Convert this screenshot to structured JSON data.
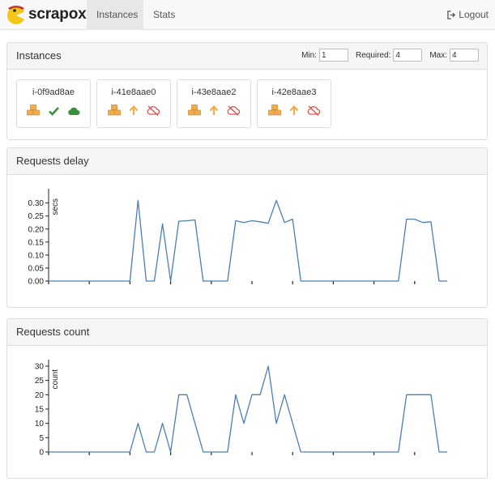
{
  "navbar": {
    "brand": "scrapoxy",
    "tabs": [
      {
        "label": "Instances",
        "active": true
      },
      {
        "label": "Stats",
        "active": false
      }
    ],
    "logout_label": "Logout",
    "logout_icon": "sign-out-icon"
  },
  "instances_panel": {
    "title": "Instances",
    "min_label": "Min:",
    "min_value": "1",
    "required_label": "Required:",
    "required_value": "4",
    "max_label": "Max:",
    "max_value": "4",
    "instances": [
      {
        "name": "i-0f9ad8ae",
        "icons": [
          "cubes-icon",
          "check-icon",
          "cloud-icon"
        ]
      },
      {
        "name": "i-41e8aae0",
        "icons": [
          "cubes-icon",
          "arrow-up-icon",
          "cloud-off-icon"
        ]
      },
      {
        "name": "i-43e8aae2",
        "icons": [
          "cubes-icon",
          "arrow-up-icon",
          "cloud-off-icon"
        ]
      },
      {
        "name": "i-42e8aae3",
        "icons": [
          "cubes-icon",
          "arrow-up-icon",
          "cloud-off-icon"
        ]
      }
    ],
    "colors": {
      "cubes": "#f0ad4e",
      "check": "#3c8f3c",
      "cloud_ok": "#3c8f3c",
      "arrow_up": "#f0ad4e",
      "cloud_off": "#d9534f"
    }
  },
  "delay_panel": {
    "title": "Requests delay"
  },
  "count_panel": {
    "title": "Requests count"
  },
  "chart_data": [
    {
      "type": "line",
      "title": "Requests delay",
      "ylabel": "secs",
      "yticks": [
        "0.00",
        "0.05",
        "0.10",
        "0.15",
        "0.20",
        "0.25",
        "0.30"
      ],
      "ylim": [
        0,
        0.33
      ],
      "color": "#4a7fb5",
      "x": [
        0,
        1,
        2,
        3,
        4,
        5,
        6,
        7,
        8,
        9,
        10,
        11,
        12,
        13,
        14,
        15,
        16,
        17,
        18,
        19,
        20,
        21,
        22,
        23,
        24,
        25,
        26,
        27,
        28,
        29,
        30,
        31,
        32,
        33,
        34,
        35,
        36,
        37,
        38,
        39,
        40,
        41,
        42,
        43,
        44,
        45,
        46,
        47,
        48,
        49
      ],
      "values": [
        0,
        0,
        0,
        0,
        0,
        0,
        0,
        0,
        0,
        0,
        0,
        0.31,
        0,
        0,
        0.22,
        0,
        0.23,
        0.232,
        0.235,
        0,
        0,
        0,
        0,
        0.232,
        0.225,
        0.232,
        0.228,
        0.222,
        0.31,
        0.225,
        0.238,
        0,
        0,
        0,
        0,
        0,
        0,
        0,
        0,
        0,
        0,
        0,
        0,
        0,
        0.238,
        0.238,
        0.225,
        0.228,
        0,
        0
      ]
    },
    {
      "type": "line",
      "title": "Requests count",
      "ylabel": "count",
      "yticks": [
        "0",
        "5",
        "10",
        "15",
        "20",
        "25",
        "30"
      ],
      "ylim": [
        0,
        30
      ],
      "color": "#4a7fb5",
      "x": [
        0,
        1,
        2,
        3,
        4,
        5,
        6,
        7,
        8,
        9,
        10,
        11,
        12,
        13,
        14,
        15,
        16,
        17,
        18,
        19,
        20,
        21,
        22,
        23,
        24,
        25,
        26,
        27,
        28,
        29,
        30,
        31,
        32,
        33,
        34,
        35,
        36,
        37,
        38,
        39,
        40,
        41,
        42,
        43,
        44,
        45,
        46,
        47,
        48,
        49
      ],
      "values": [
        0,
        0,
        0,
        0,
        0,
        0,
        0,
        0,
        0,
        0,
        0,
        10,
        0,
        0,
        10,
        0,
        20,
        20,
        10,
        0,
        0,
        0,
        0,
        20,
        10,
        20,
        20,
        30,
        10,
        20,
        10,
        0,
        0,
        0,
        0,
        0,
        0,
        0,
        0,
        0,
        0,
        0,
        0,
        0,
        20,
        20,
        20,
        20,
        0,
        0
      ]
    }
  ]
}
